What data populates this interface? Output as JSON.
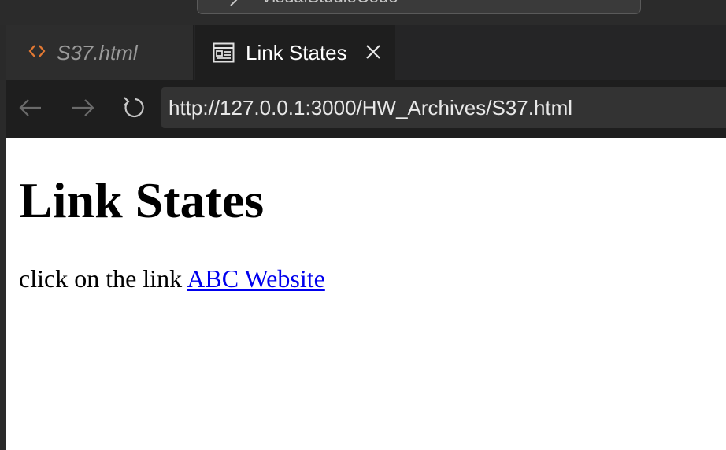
{
  "window": {
    "command_center_label": "VisualStudioCode"
  },
  "tabs": [
    {
      "label": "S37.html",
      "icon": "html-code-icon",
      "active": false
    },
    {
      "label": "Link States",
      "icon": "preview-icon",
      "active": true,
      "close_icon": "close-icon"
    }
  ],
  "browser": {
    "url": "http://127.0.0.1:3000/HW_Archives/S37.html",
    "back_icon": "back-arrow-icon",
    "forward_icon": "forward-arrow-icon",
    "reload_icon": "reload-icon"
  },
  "page": {
    "heading": "Link States",
    "paragraph_text": "click on the link ",
    "link_text": "ABC Website",
    "link_color": "#0000ee"
  },
  "colors": {
    "html_icon": "#e37933",
    "editor_bg": "#1e1e1e",
    "inactive_tab_bg": "#2d2d2d",
    "url_bar_bg": "#333333"
  }
}
